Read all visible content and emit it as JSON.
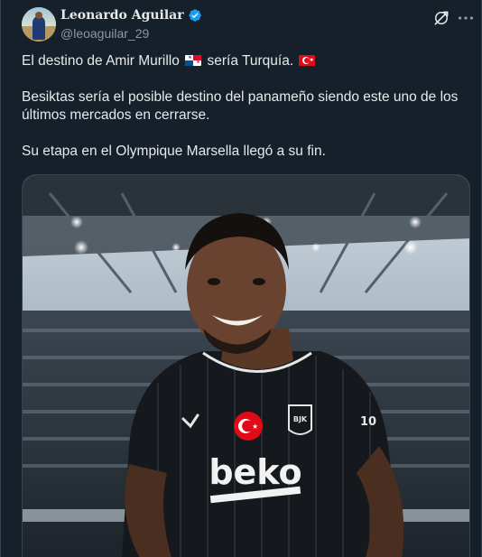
{
  "author": {
    "display_name": "Leonardo Aguilar",
    "handle": "@leoaguilar_29"
  },
  "tweet": {
    "line1_before_flag": "El destino de Amir Murillo",
    "line1_middle": "sería Turquía.",
    "paragraph2": "Besiktas sería el posible destino del panameño siendo este uno de los últimos mercados en cerrarse.",
    "paragraph3": "Su etapa en el Olympique Marsella llegó a su fin.",
    "flags": [
      "panama-flag",
      "turkey-flag"
    ]
  },
  "media": {
    "jersey_sponsor": "beko",
    "jersey_number": "10",
    "badge_text": "BJK",
    "jersey_brand": "HUMMEL"
  },
  "colors": {
    "background": "#15202b",
    "text": "#e7e9ea",
    "muted": "#8b98a5",
    "verified": "#1d9bf0"
  },
  "icons": [
    "verified-badge-icon",
    "grok-icon",
    "more-options-icon"
  ]
}
